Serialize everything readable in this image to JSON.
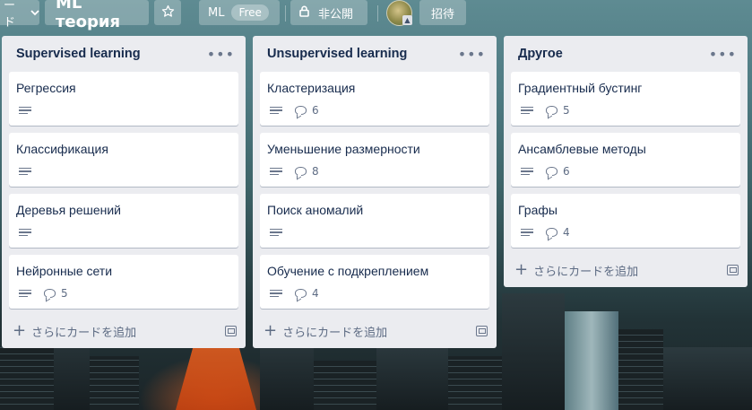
{
  "header": {
    "board_switcher_label": "ード",
    "board_title": "ML теория",
    "team_name": "ML",
    "team_plan": "Free",
    "visibility_label": "非公開",
    "invite_label": "招待"
  },
  "lists": [
    {
      "title": "Supervised learning",
      "cards": [
        {
          "title": "Регрессия",
          "comments": null
        },
        {
          "title": "Классификация",
          "comments": null
        },
        {
          "title": "Деревья решений",
          "comments": null
        },
        {
          "title": "Нейронные сети",
          "comments": "5"
        }
      ],
      "add_card_label": "さらにカードを追加"
    },
    {
      "title": "Unsupervised learning",
      "cards": [
        {
          "title": "Кластеризация",
          "comments": "6"
        },
        {
          "title": "Уменьшение размерности",
          "comments": "8"
        },
        {
          "title": "Поиск аномалий",
          "comments": null
        },
        {
          "title": "Обучение с подкреплением",
          "comments": "4"
        }
      ],
      "add_card_label": "さらにカードを追加"
    },
    {
      "title": "Другое",
      "cards": [
        {
          "title": "Градиентный бустинг",
          "comments": "5"
        },
        {
          "title": "Ансамблевые методы",
          "comments": "6"
        },
        {
          "title": "Графы",
          "comments": "4"
        }
      ],
      "add_card_label": "さらにカードを追加"
    }
  ]
}
